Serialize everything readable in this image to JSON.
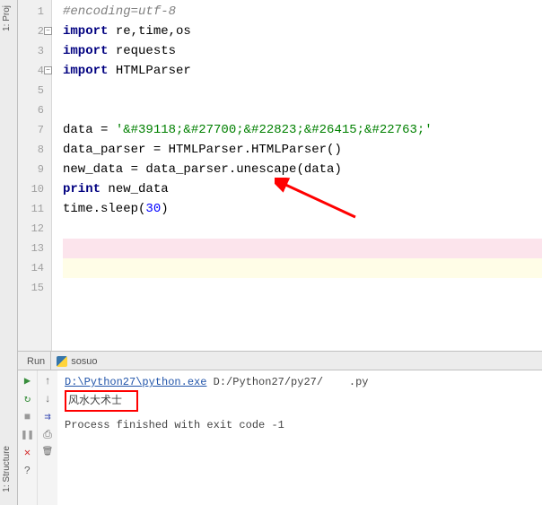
{
  "left_tabs": {
    "project": "1: Proj",
    "structure": "1: Structure"
  },
  "gutter": {
    "lines": [
      "1",
      "2",
      "3",
      "4",
      "5",
      "6",
      "7",
      "8",
      "9",
      "10",
      "11",
      "12",
      "13",
      "14",
      "15"
    ]
  },
  "code": {
    "l1_comment": "#encoding=utf-8",
    "kw_import": "import",
    "l2_mods": " re,time,os",
    "l3_mods": " requests",
    "l4_mods": " HTMLParser",
    "l7a": "data = ",
    "l7b": "'&#39118;&#27700;&#22823;&#26415;&#22763;'",
    "l8": "data_parser = HTMLParser.HTMLParser()",
    "l9": "new_data = data_parser.unescape(data)",
    "kw_print": "print",
    "l10b": " new_data",
    "l11a": "time.sleep(",
    "l11b": "30",
    "l11c": ")"
  },
  "run": {
    "label": "Run",
    "name": "sosuo",
    "out1a": "D:\\Python27\\python.exe",
    "out1b": " D:/Python27/py27/",
    "out1c": ".py",
    "out2": "风水大术士",
    "out3": "Process finished with exit code -1"
  },
  "icons": {
    "play": "▶",
    "down": "↓",
    "rerun": "↻",
    "stop": "■",
    "pause": "❚❚",
    "close": "✕",
    "help": "?",
    "up": "↑",
    "tree": "⇉",
    "print": "⎙",
    "trash": "🗑"
  }
}
